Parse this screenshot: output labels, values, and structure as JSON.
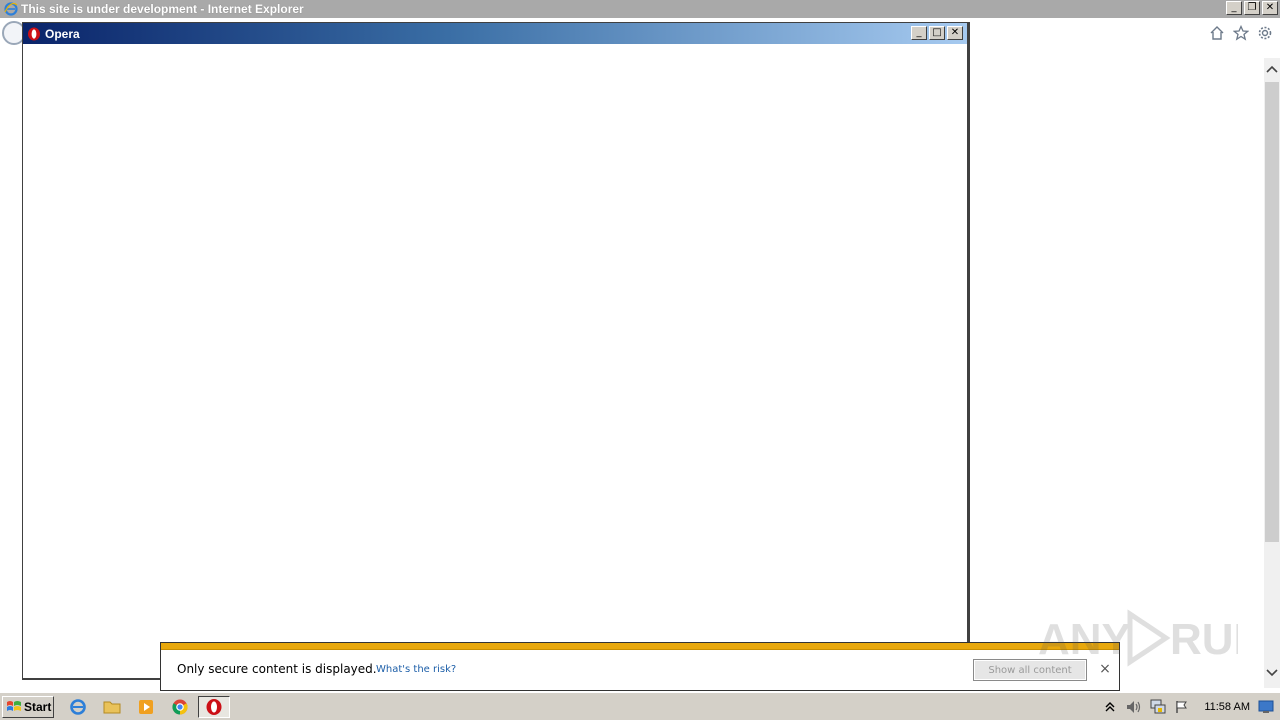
{
  "ie_window": {
    "title": "This site is under development - Internet Explorer",
    "controls": {
      "minimize": "_",
      "restore": "❐",
      "close": "✕"
    },
    "toolbar_icons": [
      "home-icon",
      "favorites-star-icon",
      "settings-gear-icon"
    ]
  },
  "opera_window": {
    "title": "Opera",
    "controls": {
      "minimize": "_",
      "maximize": "□",
      "close": "✕"
    }
  },
  "notification": {
    "message": "Only secure content is displayed.",
    "link": "What's the risk?",
    "button": "Show all content",
    "close": "×",
    "accent_color": "#e8a80c"
  },
  "watermark": "ANY RUN",
  "taskbar": {
    "start_label": "Start",
    "apps": [
      "internet-explorer-icon",
      "folder-icon",
      "media-player-icon",
      "chrome-icon",
      "opera-icon"
    ],
    "tray_icons": [
      "tray-expand-icon",
      "volume-icon",
      "network-icon",
      "action-center-flag-icon"
    ],
    "clock": "11:58 AM"
  }
}
